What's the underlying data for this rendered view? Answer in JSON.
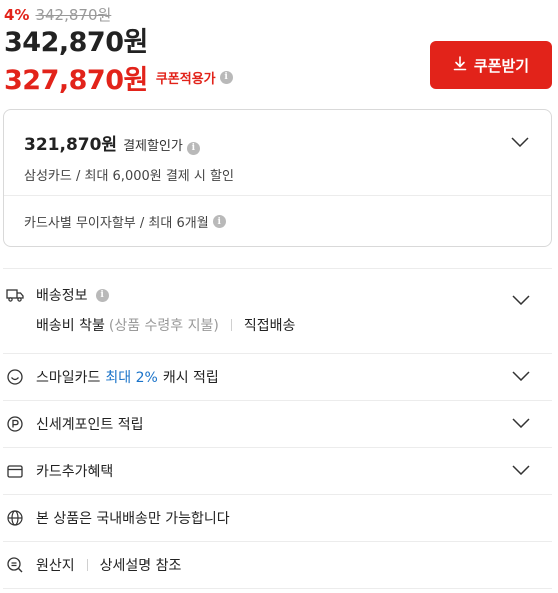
{
  "price": {
    "discount_rate": "4%",
    "original_price": "342,870원",
    "sale_price": "342,870원",
    "coupon_price": "327,870원",
    "coupon_label": "쿠폰적용가"
  },
  "coupon_button": {
    "label": "쿠폰받기"
  },
  "payment": {
    "price": "321,870원",
    "label": "결제할인가",
    "card_discount": "삼성카드 / 최대 6,000원 결제 시 할인",
    "installment": "카드사별 무이자할부 / 최대 6개월"
  },
  "shipping": {
    "title": "배송정보",
    "fee": "배송비 착불",
    "fee_note": "(상품 수령후 지불)",
    "method": "직접배송"
  },
  "smile_card": {
    "prefix": "스마일카드",
    "highlight": "최대 2%",
    "suffix": "캐시 적립"
  },
  "points": {
    "label": "신세계포인트 적립"
  },
  "card_benefit": {
    "label": "카드추가혜택"
  },
  "domestic": {
    "label": "본 상품은 국내배송만 가능합니다"
  },
  "origin": {
    "label": "원산지",
    "value": "상세설명 참조"
  },
  "colors": {
    "accent": "#e2231a",
    "link": "#1a73c9"
  },
  "icons": [
    "info-icon",
    "download-icon",
    "chevron-down-icon",
    "truck-icon",
    "smile-icon",
    "point-icon",
    "card-icon",
    "globe-icon",
    "search-icon"
  ]
}
